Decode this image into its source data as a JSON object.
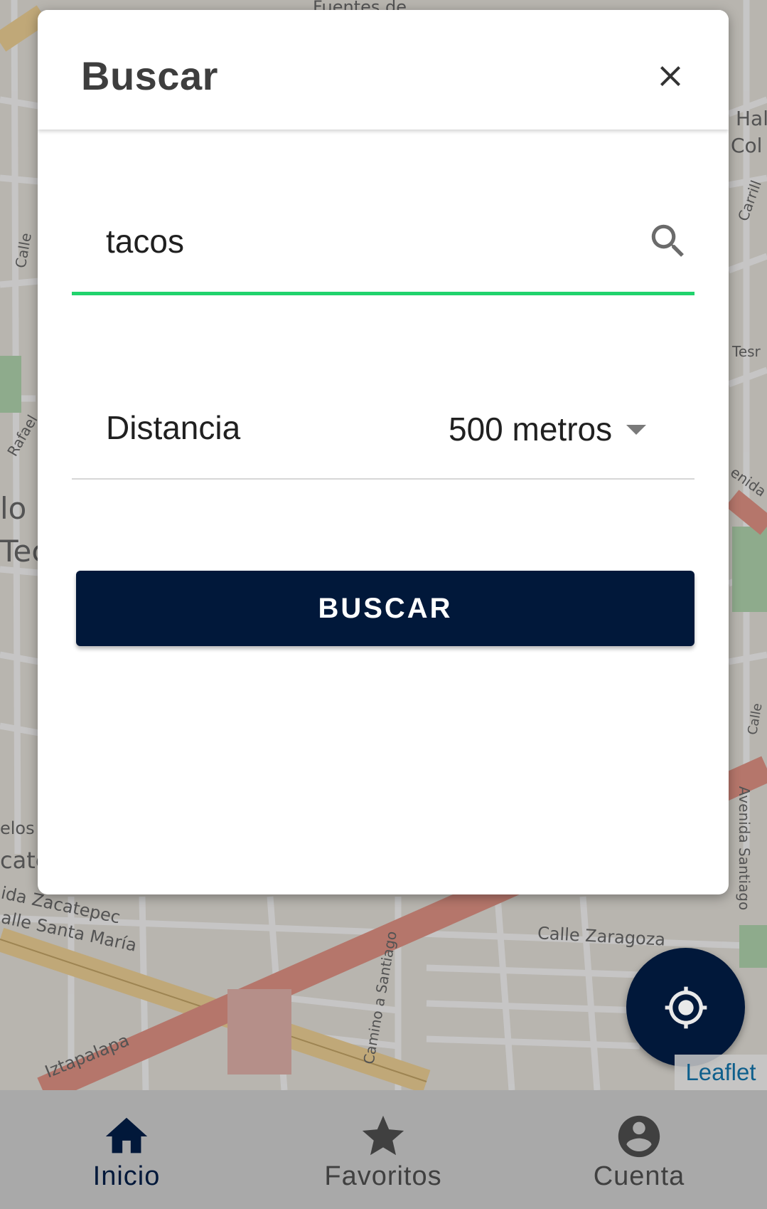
{
  "dialog": {
    "title": "Buscar",
    "close_icon": "close-icon"
  },
  "search": {
    "value": "tacos",
    "placeholder": "",
    "icon": "search-icon",
    "accent_color": "#21d36d"
  },
  "distance": {
    "label": "Distancia",
    "selected": "500 metros",
    "caret_icon": "caret-down-icon"
  },
  "submit": {
    "label": "BUSCAR",
    "color": "#01183a"
  },
  "map": {
    "labels": [
      "Fuentes de",
      "Calle Zaragoza",
      "Avenida Santiago",
      "Camino a Santiago",
      "Iztapalapa",
      "ida Zacatepec",
      "alle Santa María",
      "Calle",
      "Rafael",
      "elos",
      "cate",
      "Col",
      "Hal",
      "Tesr",
      "enida",
      "Carrill",
      "Calle",
      "lo",
      "Tec"
    ],
    "attribution": "Leaflet"
  },
  "fab": {
    "icon": "crosshair-location-icon"
  },
  "bottom_nav": {
    "items": [
      {
        "label": "Inicio",
        "icon": "home-icon",
        "active": true
      },
      {
        "label": "Favoritos",
        "icon": "star-icon",
        "active": false
      },
      {
        "label": "Cuenta",
        "icon": "account-circle-icon",
        "active": false
      }
    ],
    "active_color": "#01183a"
  }
}
